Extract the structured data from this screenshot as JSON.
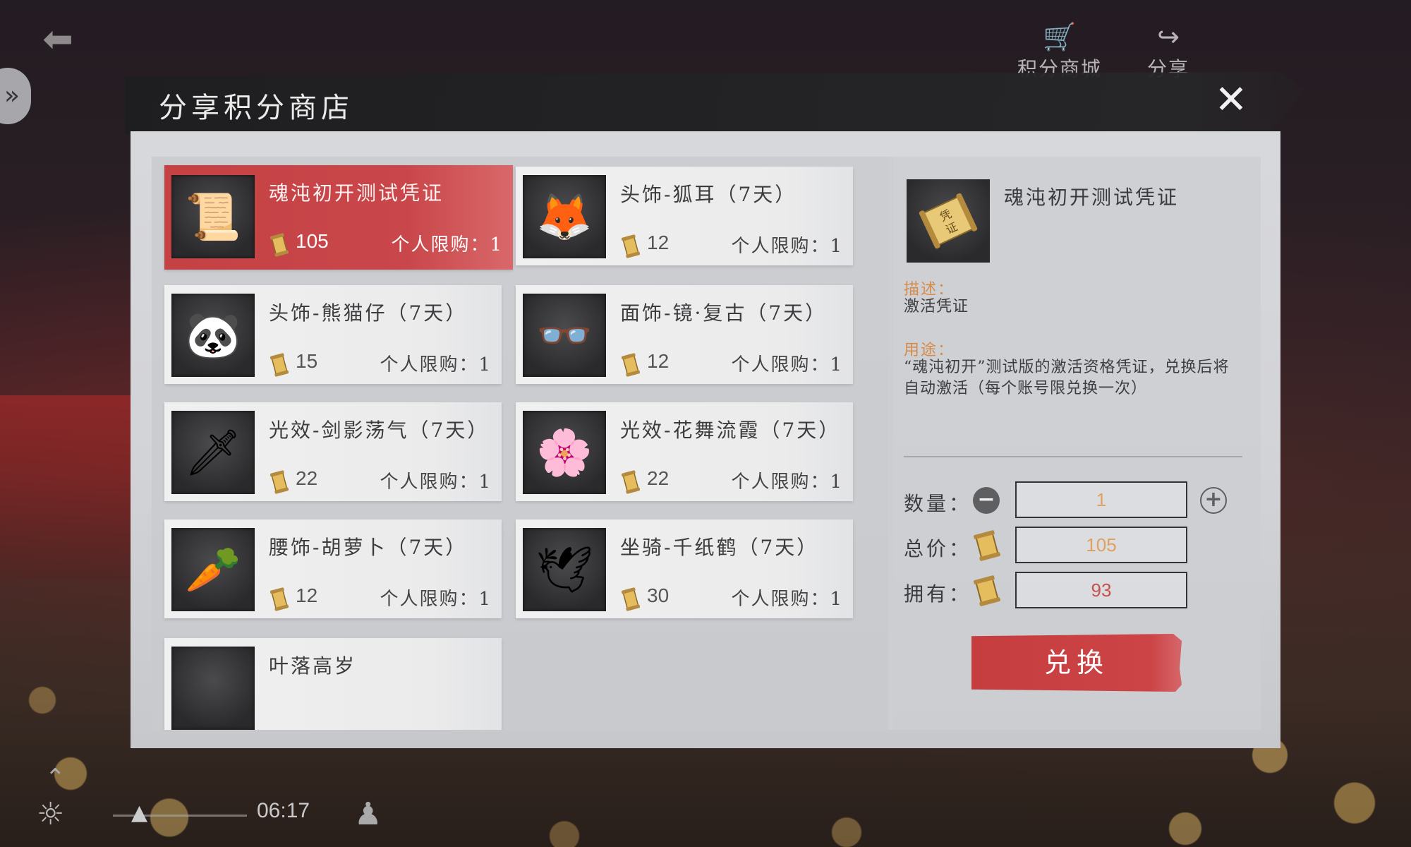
{
  "hud": {
    "back_icon": "back-arrow-icon",
    "side_toggle_icon": "double-chevron-right-icon",
    "points_mall": {
      "label": "积分商城",
      "icon": "cart-icon"
    },
    "share": {
      "label": "分享",
      "icon": "share-icon"
    },
    "time": "06:17"
  },
  "dialog": {
    "title": "分享积分商店",
    "close_icon": "close-icon"
  },
  "items": [
    {
      "name": "魂沌初开测试凭证",
      "price": "105",
      "limit": "个人限购：1",
      "thumb": "📜",
      "selected": true
    },
    {
      "name": "头饰-狐耳（7天）",
      "price": "12",
      "limit": "个人限购：1",
      "thumb": "🦊",
      "selected": false
    },
    {
      "name": "头饰-熊猫仔（7天）",
      "price": "15",
      "limit": "个人限购：1",
      "thumb": "🐼",
      "selected": false
    },
    {
      "name": "面饰-镜·复古（7天）",
      "price": "12",
      "limit": "个人限购：1",
      "thumb": "👓",
      "selected": false
    },
    {
      "name": "光效-剑影荡气（7天）",
      "price": "22",
      "limit": "个人限购：1",
      "thumb": "🗡",
      "selected": false
    },
    {
      "name": "光效-花舞流霞（7天）",
      "price": "22",
      "limit": "个人限购：1",
      "thumb": "🌸",
      "selected": false
    },
    {
      "name": "腰饰-胡萝卜（7天）",
      "price": "12",
      "limit": "个人限购：1",
      "thumb": "🥕",
      "selected": false
    },
    {
      "name": "坐骑-千纸鹤（7天）",
      "price": "30",
      "limit": "个人限购：1",
      "thumb": "🕊",
      "selected": false
    },
    {
      "name": "叶落高岁",
      "price": "",
      "limit": "",
      "thumb": "",
      "selected": false
    }
  ],
  "detail": {
    "name": "魂沌初开测试凭证",
    "desc_label": "描述：",
    "desc": "激活凭证",
    "usage_label": "用途：",
    "usage": "“魂沌初开”测试版的激活资格凭证，兑换后将自动激活（每个账号限兑换一次）",
    "quantity_label": "数量：",
    "quantity": "1",
    "total_label": "总价：",
    "total": "105",
    "owned_label": "拥有：",
    "owned": "93",
    "exchange_label": "兑换"
  },
  "colors": {
    "accent_red": "#c63d40",
    "label_orange": "#d58a49",
    "owned_red": "#c8504c"
  }
}
